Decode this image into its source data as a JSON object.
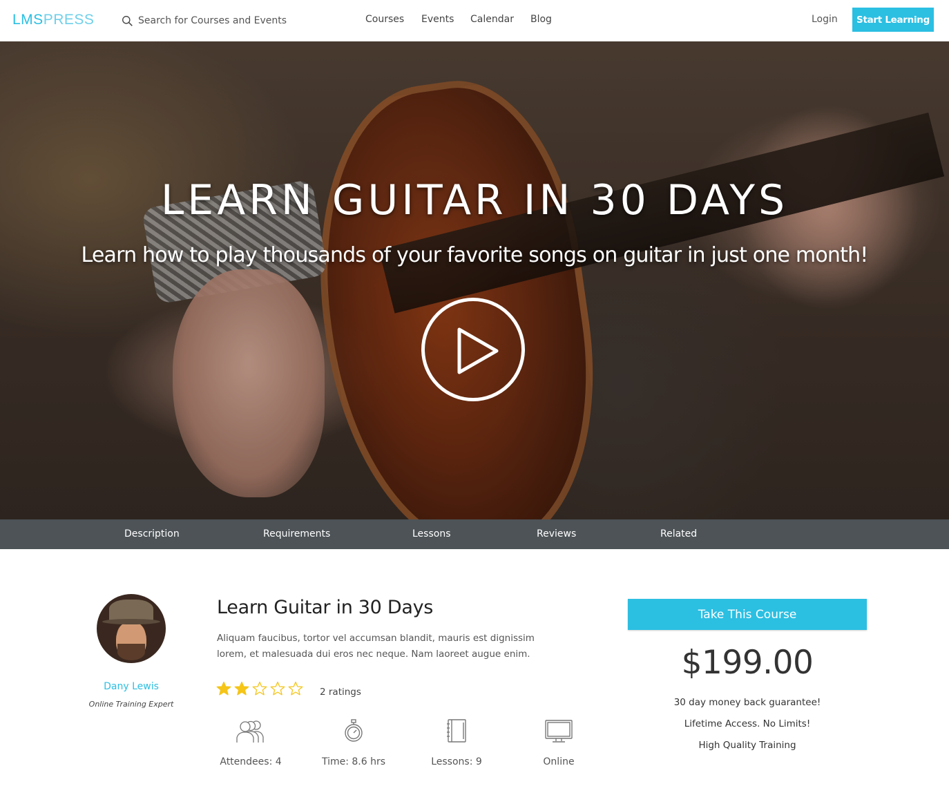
{
  "header": {
    "logo_part1": "LMS",
    "logo_part2": "PRESS",
    "search_placeholder": "Search for Courses and Events",
    "nav": [
      "Courses",
      "Events",
      "Calendar",
      "Blog"
    ],
    "login": "Login",
    "cta": "Start Learning"
  },
  "hero": {
    "title": "LEARN GUITAR IN 30 DAYS",
    "subtitle": "Learn how to play thousands of your favorite songs on guitar in just one month!"
  },
  "tabs": [
    "Description",
    "Requirements",
    "Lessons",
    "Reviews",
    "Related"
  ],
  "instructor": {
    "name": "Dany Lewis",
    "role": "Online Training Expert"
  },
  "course": {
    "title": "Learn Guitar in 30 Days",
    "description": "Aliquam faucibus, tortor vel accumsan blandit, mauris est dignissim lorem, et malesuada dui eros nec neque. Nam laoreet augue enim.",
    "rating_stars": 2,
    "rating_max": 5,
    "ratings_text": "2 ratings",
    "stats": [
      {
        "icon": "attendees-icon",
        "label": "Attendees: 4"
      },
      {
        "icon": "stopwatch-icon",
        "label": "Time: 8.6 hrs"
      },
      {
        "icon": "notebook-icon",
        "label": "Lessons: 9"
      },
      {
        "icon": "monitor-icon",
        "label": "Online"
      }
    ]
  },
  "purchase": {
    "button": "Take This Course",
    "price": "$199.00",
    "perks": [
      "30 day money back guarantee!",
      "Lifetime Access. No Limits!",
      "High Quality Training"
    ]
  },
  "colors": {
    "accent": "#2bbfe2",
    "tab_bar": "#4d5357",
    "star": "#f5c518"
  }
}
